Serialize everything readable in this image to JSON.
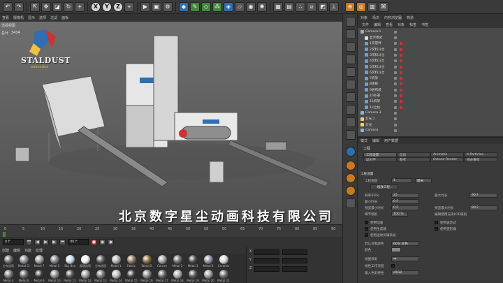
{
  "viewport": {
    "menu": [
      "查看",
      "摄像机",
      "显示",
      "选项",
      "过滤",
      "面板"
    ],
    "label": "透视视图",
    "hud_key": "总计",
    "hud_val": "3434",
    "logo_text": "STALDUST",
    "logo_sub": "animation",
    "watermark": "北京数字星尘动画科技有限公司"
  },
  "timeline": {
    "ticks": [
      "0",
      "5",
      "10",
      "15",
      "20",
      "25",
      "30",
      "35",
      "40",
      "45",
      "50",
      "55",
      "60",
      "65",
      "70",
      "75",
      "80",
      "85",
      "90"
    ],
    "start": "0 F",
    "end": "90 F"
  },
  "materials": {
    "menu": [
      "创建",
      "编辑",
      "功能",
      "纹理"
    ],
    "items": [
      {
        "name": "分布选项",
        "color": "#6d6d6d"
      },
      {
        "name": "Metal Cl",
        "color": "#8a8f96"
      },
      {
        "name": "Metal 7",
        "color": "#9a9a9a"
      },
      {
        "name": "Metal 5",
        "color": "#7d8087"
      },
      {
        "name": "Sky Bes",
        "color": "#c9d6e8"
      },
      {
        "name": "照明选项",
        "color": "#f0f0f0"
      },
      {
        "name": "分布选项",
        "color": "#5b5b5b"
      },
      {
        "name": "Metal 1",
        "color": "#b0b0b0"
      },
      {
        "name": "Fabric",
        "color": "#8c7a5a"
      },
      {
        "name": "Wood 2",
        "color": "#8a6a3a"
      },
      {
        "name": "Concre",
        "color": "#a0a0a0"
      },
      {
        "name": "Metal 2",
        "color": "#6f6f6f"
      },
      {
        "name": "Metal 3",
        "color": "#4a4a4a"
      },
      {
        "name": "Metal 8",
        "color": "#9090a0"
      },
      {
        "name": "Ceramic",
        "color": "#d8d8d8"
      },
      {
        "name": "Metal 4",
        "color": "#7a7a7a"
      },
      {
        "name": "Metal 6",
        "color": "#6a6a6a"
      },
      {
        "name": "Metal 9",
        "color": "#3d3d3d"
      },
      {
        "name": "Metal 10",
        "color": "#8d8d8d"
      },
      {
        "name": "Metal 11",
        "color": "#555555"
      },
      {
        "name": "Metal 12",
        "color": "#999999"
      },
      {
        "name": "Metal 13",
        "color": "#777777"
      },
      {
        "name": "Metal 14",
        "color": "#bbbbbb"
      },
      {
        "name": "Metal 15",
        "color": "#444444"
      },
      {
        "name": "Metal 16",
        "color": "#888888"
      },
      {
        "name": "Metal 17",
        "color": "#666666"
      },
      {
        "name": "Metal 18",
        "color": "#aaaaaa"
      },
      {
        "name": "Metal 19",
        "color": "#5a5a5a"
      },
      {
        "name": "Metal 20",
        "color": "#9c9c9c"
      },
      {
        "name": "Metal 21",
        "color": "#6c6c6c"
      }
    ]
  },
  "coords": {
    "x_label": "X",
    "y_label": "Y",
    "z_label": "Z"
  },
  "object_manager": {
    "tabs": [
      "对象",
      "场次",
      "内容浏览器",
      "构造"
    ],
    "menu": [
      "文件",
      "编辑",
      "查看",
      "对象",
      "标签",
      "书签"
    ],
    "rows": [
      "Camera.1",
      "显示模式",
      "1次搅拌",
      "2次料斗仓",
      "3次料斗仓",
      "4次料斗仓",
      "5次料斗仓",
      "6次料斗仓",
      "7机架",
      "8连接",
      "9层布袋",
      "10外罩",
      "11机架",
      "12立柱",
      "Camera.3",
      "灯光.1",
      "灯光",
      "Camera"
    ]
  },
  "attribute_manager": {
    "tabs": [
      "模式",
      "编辑",
      "用户数据"
    ],
    "title": "工程",
    "subtabs": [
      "工程设置",
      "信息",
      "Animatic",
      "X-Particles",
      "动力学",
      "参考",
      "Octane Render",
      "待办事项"
    ],
    "section": "工程设置",
    "rows": [
      {
        "label": "工程缩放",
        "value": "1",
        "unit": "厘米"
      },
      {
        "label": "帧率(FPS)",
        "value": "25"
      },
      {
        "label": "最小时长",
        "value": "0 F"
      },
      {
        "label": "最大时长",
        "value": "90 F"
      },
      {
        "label": "预览最小时长",
        "value": "0 F"
      },
      {
        "label": "预览最大时长",
        "value": "90 F"
      },
      {
        "label": "细节级别",
        "value": "100 %"
      },
      {
        "label": "编辑使用渲染LOD级别",
        "value": ""
      },
      {
        "label": "使用动画",
        "value": ""
      },
      {
        "label": "使用表达式",
        "value": ""
      },
      {
        "label": "使用生成器",
        "value": ""
      },
      {
        "label": "使用变形器",
        "value": ""
      },
      {
        "label": "使用运动剪辑系统",
        "value": ""
      },
      {
        "label": "默认对象颜色",
        "value": "60% 灰色"
      },
      {
        "label": "颜色",
        "value": ""
      },
      {
        "label": "视图修剪",
        "value": "中"
      },
      {
        "label": "线性工作流程",
        "value": ""
      },
      {
        "label": "输入色彩特性",
        "value": "sRGB"
      }
    ],
    "scale_btn": "缩放工程..."
  }
}
